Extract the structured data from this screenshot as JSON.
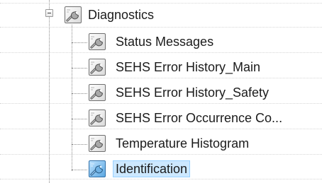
{
  "tree": {
    "root": {
      "label": "Diagnostics",
      "expanded": true,
      "icon": "wrench-config-icon"
    },
    "children": [
      {
        "label": "Status Messages",
        "icon": "wrench-config-icon",
        "selected": false
      },
      {
        "label": "SEHS Error History_Main",
        "icon": "wrench-config-icon",
        "selected": false
      },
      {
        "label": "SEHS Error History_Safety",
        "icon": "wrench-config-icon",
        "selected": false
      },
      {
        "label": "SEHS Error Occurrence Co...",
        "icon": "wrench-config-icon",
        "selected": false
      },
      {
        "label": "Temperature Histogram",
        "icon": "wrench-config-icon",
        "selected": false
      },
      {
        "label": "Identification",
        "icon": "wrench-config-icon",
        "selected": true
      }
    ],
    "colors": {
      "selection_fill": "#cce8ff",
      "selection_border": "#99d1ff",
      "text": "#1b1b1b",
      "connector": "#8a8a8a"
    }
  }
}
